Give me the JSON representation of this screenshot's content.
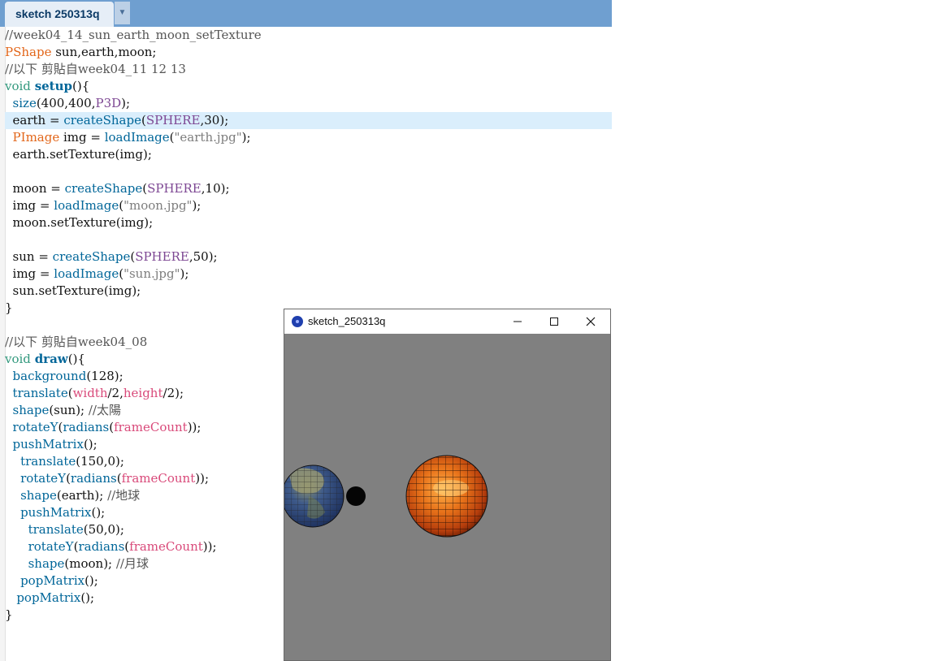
{
  "tab": {
    "label": "sketch 250313q",
    "menu_arrow": "▼"
  },
  "code": [
    [
      {
        "t": "//week04_14_sun_earth_moon_setTexture",
        "c": "c-com"
      }
    ],
    [
      {
        "t": "PShape",
        "c": "c-type"
      },
      {
        "t": " sun,earth,moon;"
      }
    ],
    [
      {
        "t": "//以下 剪貼自week04_11 12 13",
        "c": "c-com"
      }
    ],
    [
      {
        "t": "void",
        "c": "c-kw"
      },
      {
        "t": " "
      },
      {
        "t": "setup",
        "c": "c-fnb"
      },
      {
        "t": "(){"
      }
    ],
    [
      {
        "t": "  "
      },
      {
        "t": "size",
        "c": "c-fn"
      },
      {
        "t": "(400,400,"
      },
      {
        "t": "P3D",
        "c": "c-const"
      },
      {
        "t": ");"
      }
    ],
    [
      {
        "t": "  earth = "
      },
      {
        "t": "createShape",
        "c": "c-fn"
      },
      {
        "t": "("
      },
      {
        "t": "SPHERE",
        "c": "c-const"
      },
      {
        "t": ",30);"
      }
    ],
    [
      {
        "t": "  "
      },
      {
        "t": "PImage",
        "c": "c-type"
      },
      {
        "t": " img = "
      },
      {
        "t": "loadImage",
        "c": "c-fn"
      },
      {
        "t": "("
      },
      {
        "t": "\"earth.jpg\"",
        "c": "c-str"
      },
      {
        "t": ");"
      }
    ],
    [
      {
        "t": "  earth.setTexture(img);"
      }
    ],
    [],
    [
      {
        "t": "  moon = "
      },
      {
        "t": "createShape",
        "c": "c-fn"
      },
      {
        "t": "("
      },
      {
        "t": "SPHERE",
        "c": "c-const"
      },
      {
        "t": ",10);"
      }
    ],
    [
      {
        "t": "  img = "
      },
      {
        "t": "loadImage",
        "c": "c-fn"
      },
      {
        "t": "("
      },
      {
        "t": "\"moon.jpg\"",
        "c": "c-str"
      },
      {
        "t": ");"
      }
    ],
    [
      {
        "t": "  moon.setTexture(img);"
      }
    ],
    [],
    [
      {
        "t": "  sun = "
      },
      {
        "t": "createShape",
        "c": "c-fn"
      },
      {
        "t": "("
      },
      {
        "t": "SPHERE",
        "c": "c-const"
      },
      {
        "t": ",50);"
      }
    ],
    [
      {
        "t": "  img = "
      },
      {
        "t": "loadImage",
        "c": "c-fn"
      },
      {
        "t": "("
      },
      {
        "t": "\"sun.jpg\"",
        "c": "c-str"
      },
      {
        "t": ");"
      }
    ],
    [
      {
        "t": "  sun.setTexture(img);"
      }
    ],
    [
      {
        "t": "}"
      }
    ],
    [],
    [
      {
        "t": "//以下 剪貼自week04_08",
        "c": "c-com"
      }
    ],
    [
      {
        "t": "void",
        "c": "c-kw"
      },
      {
        "t": " "
      },
      {
        "t": "draw",
        "c": "c-fnb"
      },
      {
        "t": "(){"
      }
    ],
    [
      {
        "t": "  "
      },
      {
        "t": "background",
        "c": "c-fn"
      },
      {
        "t": "(128);"
      }
    ],
    [
      {
        "t": "  "
      },
      {
        "t": "translate",
        "c": "c-fn"
      },
      {
        "t": "("
      },
      {
        "t": "width",
        "c": "c-var"
      },
      {
        "t": "/2,"
      },
      {
        "t": "height",
        "c": "c-var"
      },
      {
        "t": "/2);"
      }
    ],
    [
      {
        "t": "  "
      },
      {
        "t": "shape",
        "c": "c-fn"
      },
      {
        "t": "(sun); "
      },
      {
        "t": "//太陽",
        "c": "c-com"
      }
    ],
    [
      {
        "t": "  "
      },
      {
        "t": "rotateY",
        "c": "c-fn"
      },
      {
        "t": "("
      },
      {
        "t": "radians",
        "c": "c-fn"
      },
      {
        "t": "("
      },
      {
        "t": "frameCount",
        "c": "c-var"
      },
      {
        "t": "));"
      }
    ],
    [
      {
        "t": "  "
      },
      {
        "t": "pushMatrix",
        "c": "c-fn"
      },
      {
        "t": "();"
      }
    ],
    [
      {
        "t": "    "
      },
      {
        "t": "translate",
        "c": "c-fn"
      },
      {
        "t": "(150,0);"
      }
    ],
    [
      {
        "t": "    "
      },
      {
        "t": "rotateY",
        "c": "c-fn"
      },
      {
        "t": "("
      },
      {
        "t": "radians",
        "c": "c-fn"
      },
      {
        "t": "("
      },
      {
        "t": "frameCount",
        "c": "c-var"
      },
      {
        "t": "));"
      }
    ],
    [
      {
        "t": "    "
      },
      {
        "t": "shape",
        "c": "c-fn"
      },
      {
        "t": "(earth); "
      },
      {
        "t": "//地球",
        "c": "c-com"
      }
    ],
    [
      {
        "t": "    "
      },
      {
        "t": "pushMatrix",
        "c": "c-fn"
      },
      {
        "t": "();"
      }
    ],
    [
      {
        "t": "      "
      },
      {
        "t": "translate",
        "c": "c-fn"
      },
      {
        "t": "(50,0);"
      }
    ],
    [
      {
        "t": "      "
      },
      {
        "t": "rotateY",
        "c": "c-fn"
      },
      {
        "t": "("
      },
      {
        "t": "radians",
        "c": "c-fn"
      },
      {
        "t": "("
      },
      {
        "t": "frameCount",
        "c": "c-var"
      },
      {
        "t": "));"
      }
    ],
    [
      {
        "t": "      "
      },
      {
        "t": "shape",
        "c": "c-fn"
      },
      {
        "t": "(moon); "
      },
      {
        "t": "//月球",
        "c": "c-com"
      }
    ],
    [
      {
        "t": "    "
      },
      {
        "t": "popMatrix",
        "c": "c-fn"
      },
      {
        "t": "();"
      }
    ],
    [
      {
        "t": "   "
      },
      {
        "t": "popMatrix",
        "c": "c-fn"
      },
      {
        "t": "();"
      }
    ],
    [
      {
        "t": "}"
      }
    ]
  ],
  "active_line": 5,
  "sketch_window": {
    "title": "sketch_250313q",
    "buttons": [
      "minimize",
      "maximize",
      "close"
    ],
    "background": "#808080"
  },
  "colors": {
    "tabbar": "#6f9fd0",
    "comment": "#555555",
    "type": "#e2661a",
    "keyword": "#33997e",
    "function": "#006699",
    "constant": "#7d4793",
    "variable": "#d94a7a",
    "string": "#7d7d7d"
  }
}
